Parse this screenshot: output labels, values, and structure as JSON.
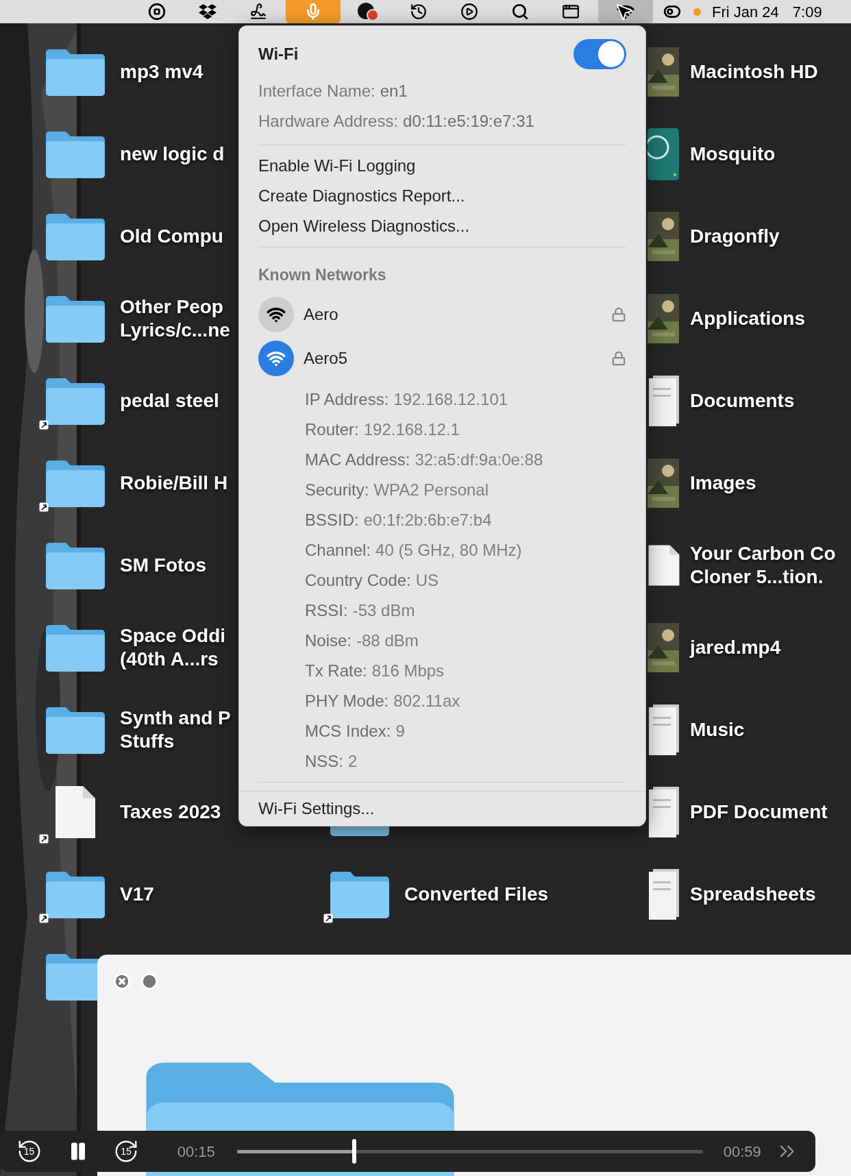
{
  "menu_bar": {
    "items": [
      {
        "kind": "stop",
        "active": false
      },
      {
        "kind": "dropbox",
        "active": false
      },
      {
        "kind": "squiggle",
        "active": false
      },
      {
        "kind": "microphone",
        "active": true
      },
      {
        "kind": "badge-app",
        "active": false
      },
      {
        "kind": "history",
        "active": false
      },
      {
        "kind": "play",
        "active": false
      },
      {
        "kind": "search",
        "active": false
      },
      {
        "kind": "keyboard",
        "active": false
      },
      {
        "kind": "wifi",
        "active": true
      },
      {
        "kind": "toggles",
        "active": false
      },
      {
        "kind": "dot",
        "active": false
      }
    ],
    "date": "Fri Jan 24",
    "time": "7:09"
  },
  "desktop": {
    "rows": [
      {
        "left": {
          "lines": [
            "mp3 mv4"
          ],
          "kind": "folder",
          "alias": false
        },
        "right": {
          "lines": [
            "Macintosh HD"
          ],
          "kind": "picture",
          "alias": false
        }
      },
      {
        "left": {
          "lines": [
            "new logic d"
          ],
          "kind": "folder",
          "alias": false
        },
        "right": {
          "lines": [
            "Mosquito"
          ],
          "kind": "drive",
          "alias": false
        }
      },
      {
        "left": {
          "lines": [
            "Old Compu"
          ],
          "kind": "folder",
          "alias": false
        },
        "right": {
          "lines": [
            "Dragonfly"
          ],
          "kind": "picture",
          "alias": false
        }
      },
      {
        "left": {
          "lines": [
            "Other Peop",
            "Lyrics/c...ne"
          ],
          "kind": "folder",
          "alias": false
        },
        "right": {
          "lines": [
            "Applications"
          ],
          "kind": "picture",
          "alias": false
        }
      },
      {
        "left": {
          "lines": [
            "pedal steel"
          ],
          "kind": "folder",
          "alias": true
        },
        "right": {
          "lines": [
            "Documents"
          ],
          "kind": "stack",
          "alias": false
        }
      },
      {
        "left": {
          "lines": [
            "Robie/Bill H"
          ],
          "kind": "folder",
          "alias": true
        },
        "right": {
          "lines": [
            "Images"
          ],
          "kind": "picture",
          "alias": false
        }
      },
      {
        "left": {
          "lines": [
            "SM Fotos"
          ],
          "kind": "folder",
          "alias": false
        },
        "right": {
          "lines": [
            "Your Carbon Co",
            "Cloner 5...tion."
          ],
          "kind": "document",
          "alias": false
        }
      },
      {
        "left": {
          "lines": [
            "Space Oddi",
            "(40th A...rs"
          ],
          "kind": "folder",
          "alias": false
        },
        "right": {
          "lines": [
            "jared.mp4"
          ],
          "kind": "picture",
          "alias": false
        }
      },
      {
        "left": {
          "lines": [
            "Synth and P",
            "Stuffs"
          ],
          "kind": "folder",
          "alias": false
        },
        "right": {
          "lines": [
            "Music"
          ],
          "kind": "stack",
          "alias": false
        }
      },
      {
        "left": {
          "lines": [
            "Taxes 2023"
          ],
          "kind": "document",
          "alias": true
        },
        "middle": {
          "kind": "folder",
          "alias": false
        },
        "right": {
          "lines": [
            "PDF Document"
          ],
          "kind": "stack",
          "alias": false
        }
      },
      {
        "left": {
          "lines": [
            "V17"
          ],
          "kind": "folder",
          "alias": true
        },
        "middle": {
          "lines": [
            "Converted Files"
          ],
          "kind": "folder",
          "alias": true
        },
        "right": {
          "lines": [
            "Spreadsheets"
          ],
          "kind": "stack",
          "alias": false
        }
      },
      {
        "left": {
          "kind": "folder",
          "alias": false
        }
      }
    ]
  },
  "wifi_menu": {
    "title": "Wi-Fi",
    "on": true,
    "info": [
      {
        "label": "Interface Name:",
        "value": "en1"
      },
      {
        "label": "Hardware Address:",
        "value": "d0:11:e5:19:e7:31"
      }
    ],
    "actions": [
      "Enable Wi-Fi Logging",
      "Create Diagnostics Report...",
      "Open Wireless Diagnostics..."
    ],
    "known_networks_heading": "Known Networks",
    "networks": [
      {
        "name": "Aero",
        "selected": false,
        "secured": true
      },
      {
        "name": "Aero5",
        "selected": true,
        "secured": true
      }
    ],
    "details": [
      {
        "label": "IP Address:",
        "value": "192.168.12.101"
      },
      {
        "label": "Router:",
        "value": "192.168.12.1"
      },
      {
        "label": "MAC Address:",
        "value": "32:a5:df:9a:0e:88"
      },
      {
        "label": "Security:",
        "value": "WPA2 Personal"
      },
      {
        "label": "BSSID:",
        "value": "e0:1f:2b:6b:e7:b4"
      },
      {
        "label": "Channel:",
        "value": "40 (5 GHz, 80 MHz)"
      },
      {
        "label": "Country Code:",
        "value": "US"
      },
      {
        "label": "RSSI:",
        "value": "-53 dBm"
      },
      {
        "label": "Noise:",
        "value": "-88 dBm"
      },
      {
        "label": "Tx Rate:",
        "value": "816 Mbps"
      },
      {
        "label": "PHY Mode:",
        "value": "802.11ax"
      },
      {
        "label": "MCS Index:",
        "value": "9"
      },
      {
        "label": "NSS:",
        "value": "2"
      }
    ],
    "settings": "Wi-Fi Settings..."
  },
  "player": {
    "skip_back": "15",
    "skip_forward": "15",
    "playing": true,
    "elapsed": "00:15",
    "total": "00:59",
    "level": 0.252
  }
}
